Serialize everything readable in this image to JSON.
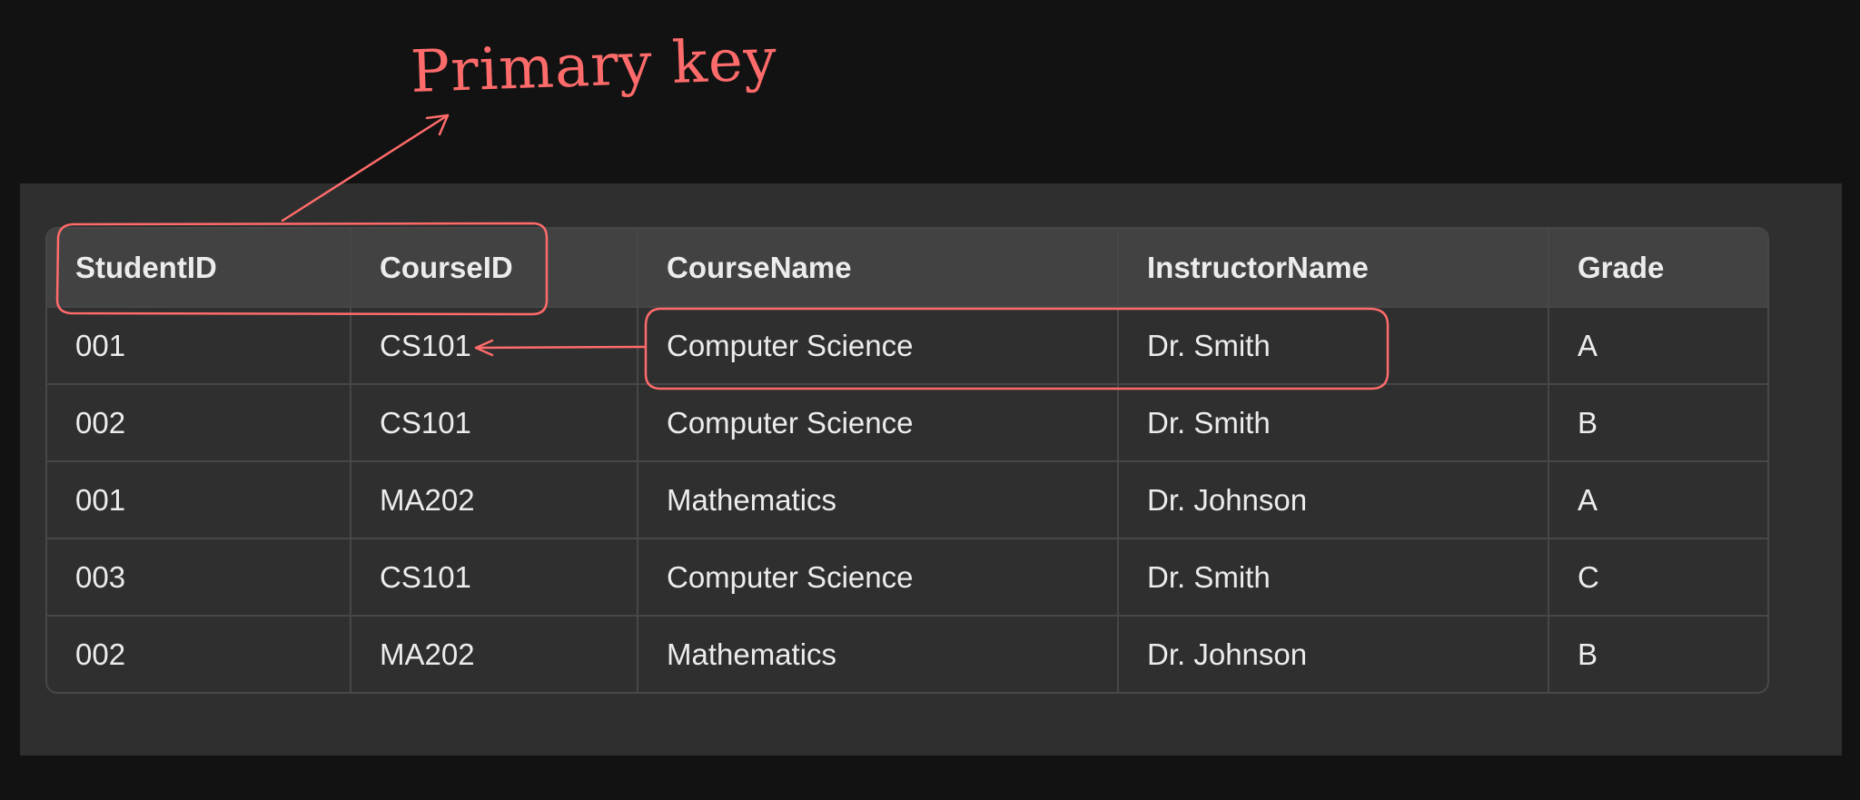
{
  "annotation": {
    "label": "Primary key",
    "color": "#ff6b6b"
  },
  "table": {
    "headers": [
      "StudentID",
      "CourseID",
      "CourseName",
      "InstructorName",
      "Grade"
    ],
    "rows": [
      [
        "001",
        "CS101",
        "Computer Science",
        "Dr. Smith",
        "A"
      ],
      [
        "002",
        "CS101",
        "Computer Science",
        "Dr. Smith",
        "B"
      ],
      [
        "001",
        "MA202",
        "Mathematics",
        "Dr. Johnson",
        "A"
      ],
      [
        "003",
        "CS101",
        "Computer Science",
        "Dr. Smith",
        "C"
      ],
      [
        "002",
        "MA202",
        "Mathematics",
        "Dr. Johnson",
        "B"
      ]
    ]
  },
  "colors": {
    "page_bg": "#121212",
    "panel_bg": "#2f2f2f",
    "header_bg": "#424242",
    "border": "#474747",
    "text": "#ececec"
  }
}
